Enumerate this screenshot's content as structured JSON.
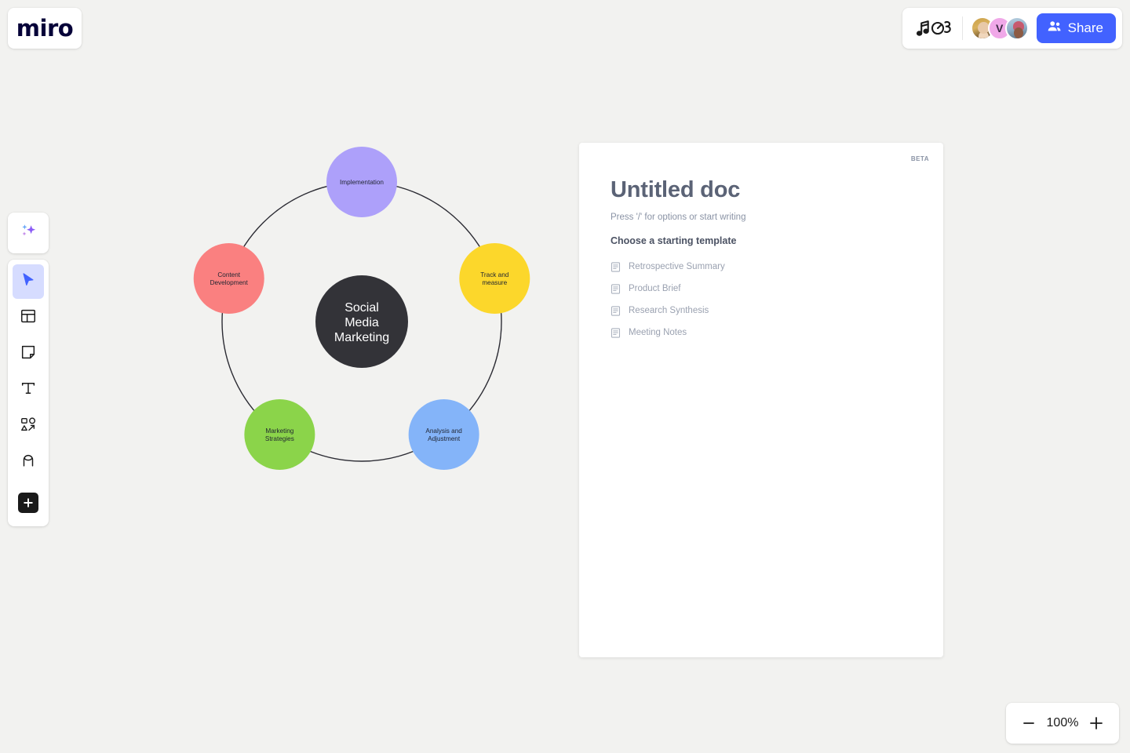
{
  "app": {
    "logo_text": "miro",
    "background_color": "#f2f2f0"
  },
  "topbar": {
    "music_icon": "music-notes-icon",
    "avatars": [
      {
        "name": "collaborator-1",
        "initial": ""
      },
      {
        "name": "collaborator-2",
        "initial": "V",
        "color": "#f0a8e8"
      },
      {
        "name": "collaborator-3",
        "initial": ""
      }
    ],
    "share_label": "Share",
    "share_color": "#4262ff"
  },
  "toolbar": {
    "items": [
      {
        "name": "ai-sparkle-tool",
        "icon": "sparkles-icon",
        "selected": false
      },
      {
        "name": "select-tool",
        "icon": "cursor-arrow-icon",
        "selected": true
      },
      {
        "name": "templates-tool",
        "icon": "layout-template-icon",
        "selected": false
      },
      {
        "name": "sticky-note-tool",
        "icon": "sticky-note-icon",
        "selected": false
      },
      {
        "name": "text-tool",
        "icon": "text-t-icon",
        "selected": false
      },
      {
        "name": "shapes-tool",
        "icon": "shapes-arrow-icon",
        "selected": false
      },
      {
        "name": "pen-tool",
        "icon": "pen-stroke-icon",
        "selected": false
      },
      {
        "name": "more-apps-tool",
        "icon": "plus-icon",
        "selected": false
      }
    ]
  },
  "chart_data": {
    "type": "diagram",
    "diagram_kind": "cycle",
    "title": "Social Media Marketing",
    "center": {
      "label": "Social Media Marketing",
      "color": "#333338",
      "text_color": "#ffffff"
    },
    "nodes": [
      {
        "label": "Implementation",
        "color": "#ada0fa",
        "angle_deg": 270
      },
      {
        "label": "Track and measure",
        "color": "#fcd72b",
        "angle_deg": 342
      },
      {
        "label": "Analysis and Adjustment",
        "color": "#84b4f9",
        "angle_deg": 54
      },
      {
        "label": "Marketing Strategies",
        "color": "#8bd44a",
        "angle_deg": 126
      },
      {
        "label": "Content Development",
        "color": "#fa8080",
        "angle_deg": 198
      }
    ],
    "ring_color": "#2b2b33",
    "ring_stroke_width": 1.4
  },
  "doc": {
    "badge": "BETA",
    "title": "Untitled doc",
    "hint": "Press '/' for options or start writing",
    "subtitle": "Choose a starting template",
    "templates": [
      {
        "label": "Retrospective Summary",
        "icon": "document-icon"
      },
      {
        "label": "Product Brief",
        "icon": "document-icon"
      },
      {
        "label": "Research Synthesis",
        "icon": "document-icon"
      },
      {
        "label": "Meeting Notes",
        "icon": "document-icon"
      }
    ]
  },
  "zoom": {
    "level": "100%",
    "minus_label": "minus-icon",
    "plus_label": "plus-icon"
  }
}
